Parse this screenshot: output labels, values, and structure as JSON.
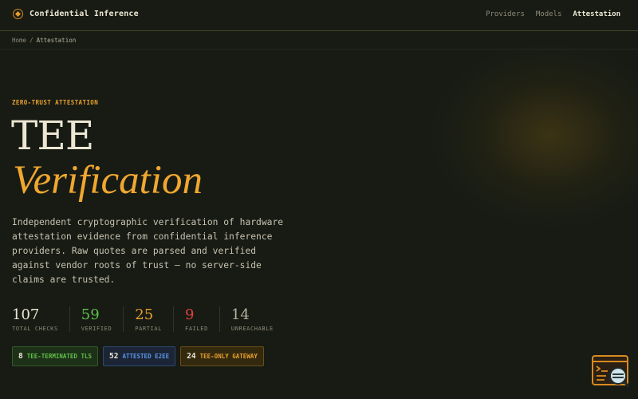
{
  "header": {
    "brand": "Confidential Inference",
    "nav": [
      "Providers",
      "Models",
      "Attestation"
    ],
    "active_nav": "Attestation"
  },
  "breadcrumb": {
    "home": "Home",
    "separator": "/",
    "current": "Attestation"
  },
  "hero": {
    "eyebrow": "ZERO-TRUST ATTESTATION",
    "title_line1": "TEE",
    "title_line2": "Verification",
    "description": "Independent cryptographic verification of hardware attestation evidence from confidential inference providers. Raw quotes are parsed and verified against vendor roots of trust — no server-side claims are trusted."
  },
  "stats": [
    {
      "value": "107",
      "label": "TOTAL CHECKS",
      "color": "#ece6d3"
    },
    {
      "value": "59",
      "label": "VERIFIED",
      "color": "#5fc04a"
    },
    {
      "value": "25",
      "label": "PARTIAL",
      "color": "#e8a02e"
    },
    {
      "value": "9",
      "label": "FAILED",
      "color": "#e0413a"
    },
    {
      "value": "14",
      "label": "UNREACHABLE",
      "color": "#b7b29f"
    }
  ],
  "badges": [
    {
      "count": "8",
      "label": "TEE-TERMINATED TLS",
      "tone": "green"
    },
    {
      "count": "52",
      "label": "ATTESTED E2EE",
      "tone": "blue"
    },
    {
      "count": "24",
      "label": "TEE-ONLY GATEWAY",
      "tone": "orange"
    }
  ],
  "colors": {
    "accent": "#f0a730",
    "background": "#171b14",
    "border": "#3c4a26"
  },
  "icons": {
    "logo": "shield-hex-icon",
    "widget": "terminal-search-icon"
  }
}
